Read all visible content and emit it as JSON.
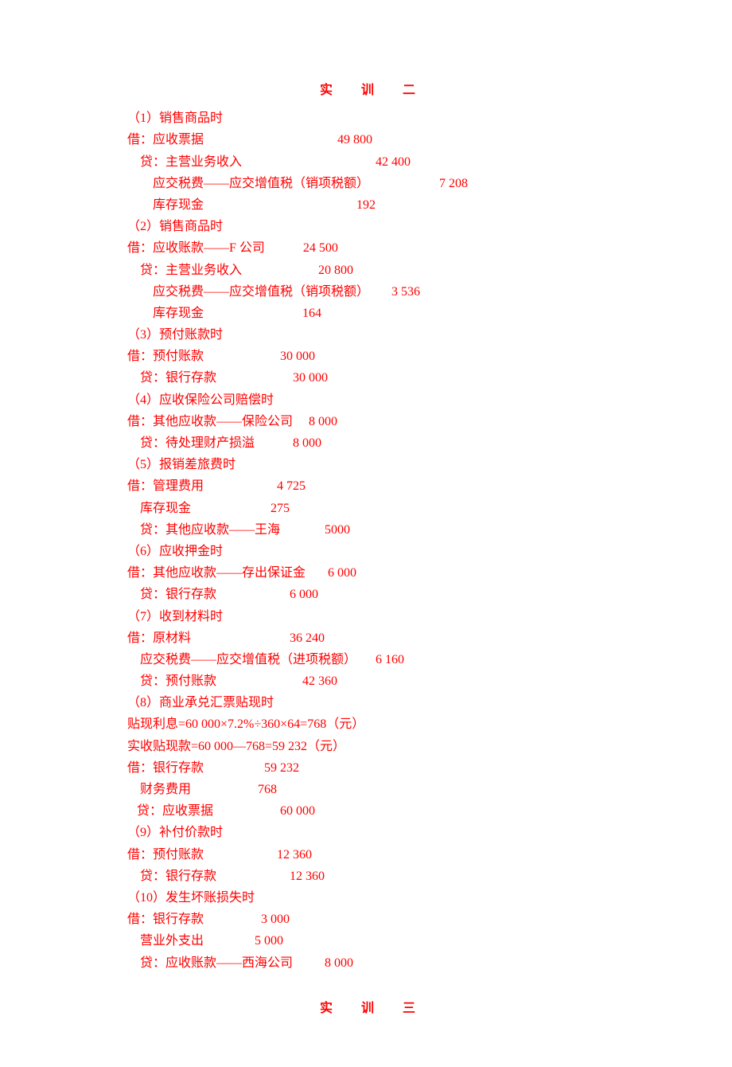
{
  "title1": "实 训 二",
  "title2": "实 训 三",
  "lines": [
    "（1）销售商品时",
    "借：应收票据                                          49 800",
    "    贷：主营业务收入                                          42 400",
    "        应交税费——应交增值税（销项税额）                      7 208",
    "        库存现金                                                192",
    "（2）销售商品时",
    "借：应收账款——F 公司            24 500",
    "    贷：主营业务收入                        20 800",
    "        应交税费——应交增值税（销项税额）       3 536",
    "        库存现金                               164",
    "（3）预付账款时",
    "借：预付账款                        30 000",
    "    贷：银行存款                        30 000",
    "（4）应收保险公司赔偿时",
    "借：其他应收款——保险公司     8 000",
    "    贷：待处理财产损溢            8 000",
    "（5）报销差旅费时",
    "借：管理费用                       4 725",
    "    库存现金                         275",
    "    贷：其他应收款——王海              5000",
    "（6）应收押金时",
    "借：其他应收款——存出保证金       6 000",
    "    贷：银行存款                       6 000",
    "（7）收到材料时",
    "借：原材料                               36 240",
    "    应交税费——应交增值税（进项税额）      6 160",
    "    贷：预付账款                           42 360",
    "（8）商业承兑汇票贴现时",
    "贴现利息=60 000×7.2%÷360×64=768（元）",
    "实收贴现款=60 000—768=59 232（元）",
    "借：银行存款                   59 232",
    "    财务费用                     768",
    "   贷：应收票据                     60 000",
    "（9）补付价款时",
    "借：预付账款                       12 360",
    "    贷：银行存款                       12 360",
    "（10）发生坏账损失时",
    "借：银行存款                  3 000",
    "    营业外支出                5 000",
    "    贷：应收账款——西海公司          8 000"
  ]
}
